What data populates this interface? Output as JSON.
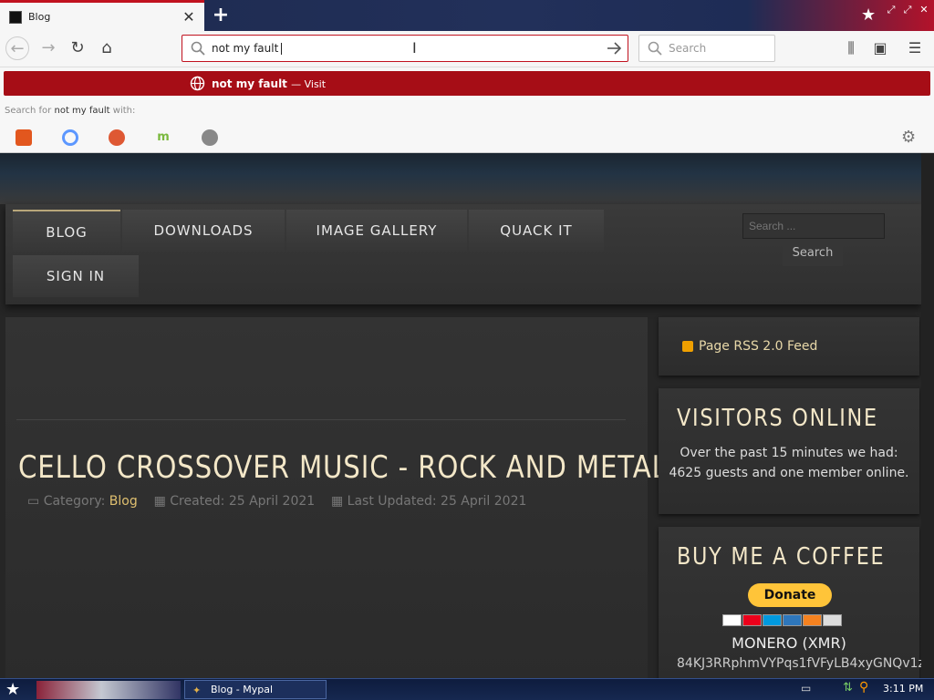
{
  "browser": {
    "tab": {
      "title": "Blog"
    },
    "url_bar": {
      "value": "not my fault"
    },
    "search_bar": {
      "placeholder": "Search"
    }
  },
  "autocomplete": {
    "visit_row": {
      "query": "not my fault",
      "suffix": "— Visit"
    },
    "search_with_prefix": "Search for",
    "search_with_query": "not my fault",
    "search_with_suffix": "with:",
    "engines": [
      {
        "name": "brave-icon",
        "color": "#e2571e"
      },
      {
        "name": "qwant-icon",
        "color": "#5c97ff"
      },
      {
        "name": "duckduckgo-icon",
        "color": "#de5833"
      },
      {
        "name": "mojeek-icon",
        "color": "#7ab93d"
      },
      {
        "name": "searx-icon",
        "color": "#888888"
      }
    ]
  },
  "site": {
    "menu": [
      "BLOG",
      "DOWNLOADS",
      "IMAGE GALLERY",
      "QUACK IT",
      "SIGN IN"
    ],
    "search": {
      "placeholder": "Search ...",
      "button": "Search"
    },
    "article": {
      "title": "CELLO CROSSOVER MUSIC - ROCK AND METAL",
      "category_label": "Category:",
      "category": "Blog",
      "created": "Created: 25 April 2021",
      "updated": "Last Updated: 25 April 2021"
    },
    "sidebar": {
      "rss": "Page RSS 2.0 Feed",
      "visitors_title": "VISITORS ONLINE",
      "visitors_text": "Over the past 15 minutes we had: 4625 guests and one member online.",
      "coffee_title": "BUY ME A COFFEE",
      "donate": "Donate",
      "monero_label": "MONERO (XMR)",
      "monero_address": "84KJ3RRphmVYPqs1fVFyLB4xyGNQv1z"
    }
  },
  "taskbar": {
    "window_label": "Blog - Mypal",
    "clock": "3:11 PM"
  },
  "colors": {
    "accent": "#c1121f",
    "visit_row": "#a60d16",
    "heading": "#f3e7c8",
    "link": "#e0c070"
  }
}
